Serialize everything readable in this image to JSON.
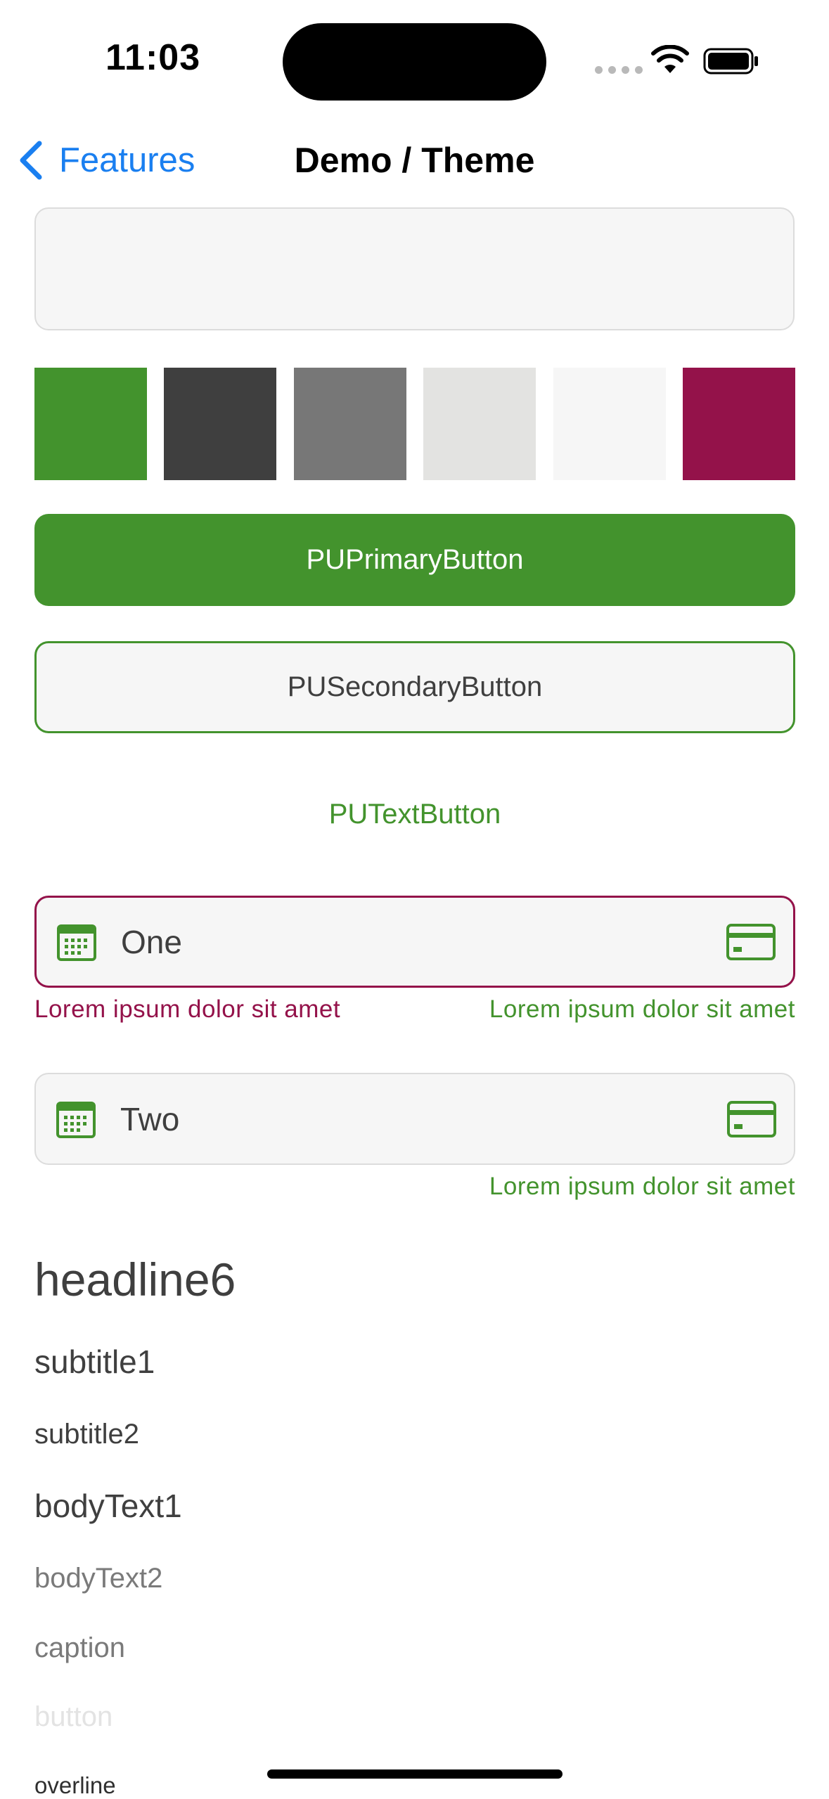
{
  "status_bar": {
    "time": "11:03"
  },
  "nav": {
    "back_label": "Features",
    "title": "Demo / Theme"
  },
  "colors": {
    "primary": "#43932d",
    "dark": "#3f3f3f",
    "medium": "#777777",
    "light": "#e3e3e1",
    "lightest": "#f6f6f6",
    "error": "#94124a",
    "ios_blue": "#1a7ff0"
  },
  "swatches": [
    "#43932d",
    "#3f3f3f",
    "#777777",
    "#e3e3e1",
    "#f6f6f6",
    "#94124a"
  ],
  "buttons": {
    "primary": "PUPrimaryButton",
    "secondary": "PUSecondaryButton",
    "text": "PUTextButton"
  },
  "fields": [
    {
      "value": "One",
      "lead_icon": "calendar-icon",
      "trail_icon": "credit-card-icon",
      "error_text": "Lorem ipsum dolor sit amet",
      "helper_text": "Lorem ipsum dolor sit amet"
    },
    {
      "value": "Two",
      "lead_icon": "calendar-icon",
      "trail_icon": "credit-card-icon",
      "helper_text": "Lorem ipsum dolor sit amet"
    }
  ],
  "typography": {
    "headline6": "headline6",
    "subtitle1": "subtitle1",
    "subtitle2": "subtitle2",
    "bodyText1": "bodyText1",
    "bodyText2": "bodyText2",
    "caption": "caption",
    "button": "button",
    "overline": "overline"
  }
}
